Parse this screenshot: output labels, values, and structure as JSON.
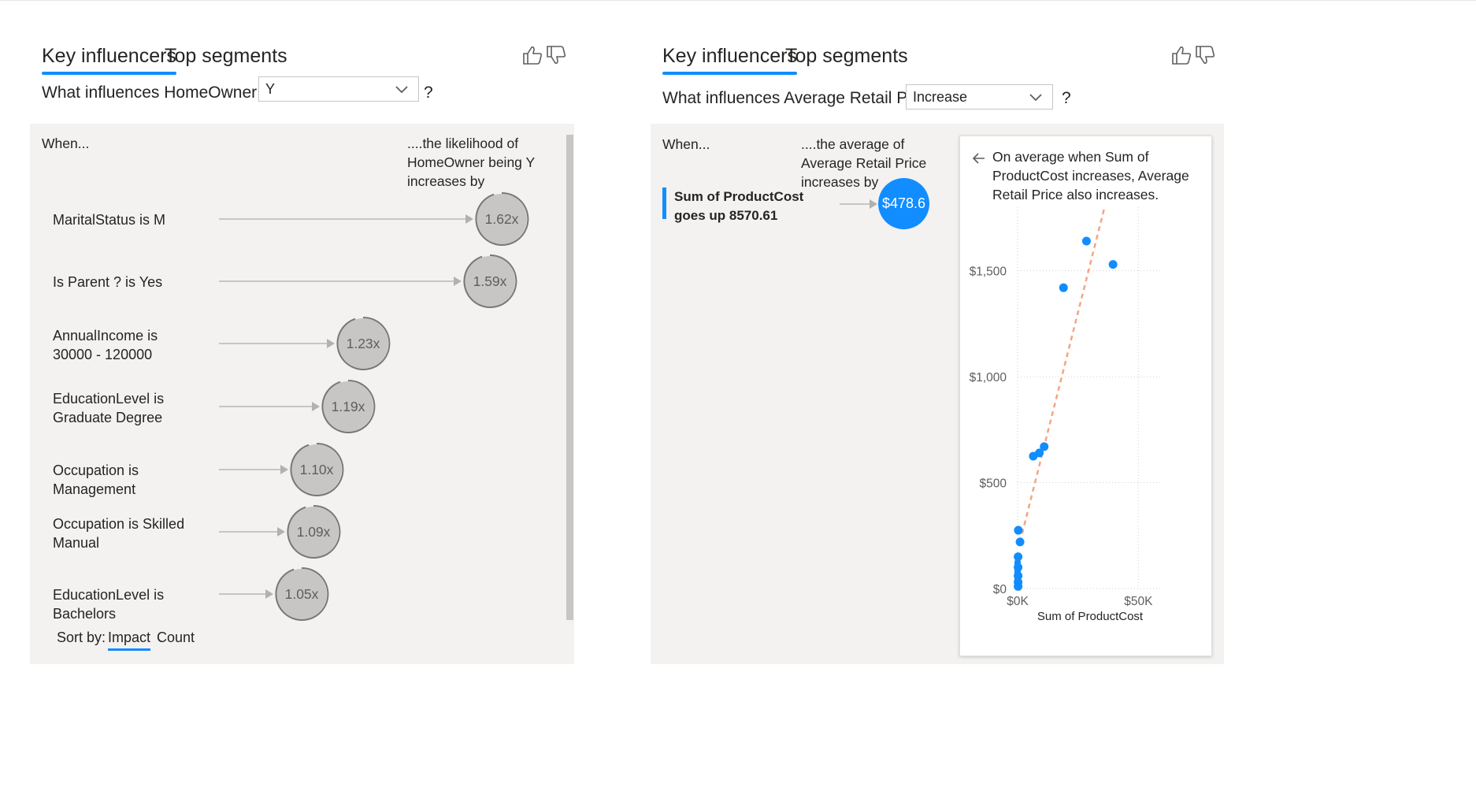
{
  "left": {
    "tabs": [
      {
        "label": "Key influencers"
      },
      {
        "label": "Top segments"
      }
    ],
    "question_prefix": "What influences HomeOwner to be",
    "dropdown_value": "Y",
    "question_suffix": "?",
    "col_when": "When...",
    "col_likelihood": "....the likelihood of HomeOwner being Y increases by",
    "factors": [
      {
        "label": "MaritalStatus is M",
        "value": "1.62x"
      },
      {
        "label": "Is Parent ? is Yes",
        "value": "1.59x"
      },
      {
        "label": "AnnualIncome is 30000 - 120000",
        "value": "1.23x"
      },
      {
        "label": "EducationLevel is Graduate Degree",
        "value": "1.19x"
      },
      {
        "label": "Occupation is Management",
        "value": "1.10x"
      },
      {
        "label": "Occupation is Skilled Manual",
        "value": "1.09x"
      },
      {
        "label": "EducationLevel is Bachelors",
        "value": "1.05x"
      }
    ],
    "sort_by_label": "Sort by:",
    "sort_options": [
      {
        "label": "Impact",
        "active": true
      },
      {
        "label": "Count",
        "active": false
      }
    ]
  },
  "right": {
    "tabs": [
      {
        "label": "Key influencers"
      },
      {
        "label": "Top segments"
      }
    ],
    "question_prefix": "What influences Average Retail Price to",
    "dropdown_value": "Increase",
    "question_suffix": "?",
    "col_when": "When...",
    "col_average": "....the average of Average Retail Price increases by",
    "factor": {
      "label": "Sum of ProductCost goes up 8570.61",
      "value": "$478.6"
    },
    "card_text": "On average when Sum of ProductCost increases, Average Retail Price also increases."
  },
  "chart_data": {
    "type": "scatter",
    "title": "",
    "xlabel": "Sum of ProductCost",
    "ylabel": "",
    "x_ticks": [
      "$0K",
      "$50K"
    ],
    "y_ticks": [
      "$0",
      "$500",
      "$1,000",
      "$1,500"
    ],
    "xlim": [
      0,
      60000
    ],
    "ylim": [
      0,
      1800
    ],
    "points": [
      {
        "x": 28500,
        "y": 1640
      },
      {
        "x": 39500,
        "y": 1530
      },
      {
        "x": 19000,
        "y": 1420
      },
      {
        "x": 11000,
        "y": 670
      },
      {
        "x": 9000,
        "y": 640
      },
      {
        "x": 6500,
        "y": 625
      },
      {
        "x": 1000,
        "y": 220
      },
      {
        "x": 300,
        "y": 275
      },
      {
        "x": 200,
        "y": 150
      },
      {
        "x": 200,
        "y": 100
      },
      {
        "x": 200,
        "y": 60
      },
      {
        "x": 200,
        "y": 30
      },
      {
        "x": 200,
        "y": 10
      }
    ],
    "trendline": {
      "x": [
        1000,
        36000
      ],
      "y": [
        220,
        1800
      ],
      "color": "#f4a582",
      "style": "dashed"
    },
    "point_color": "#118dff",
    "grid": true
  },
  "colors": {
    "accent": "#118dff",
    "bubble_gray": "#c8c6c4",
    "panel_bg": "#f3f2f1"
  }
}
